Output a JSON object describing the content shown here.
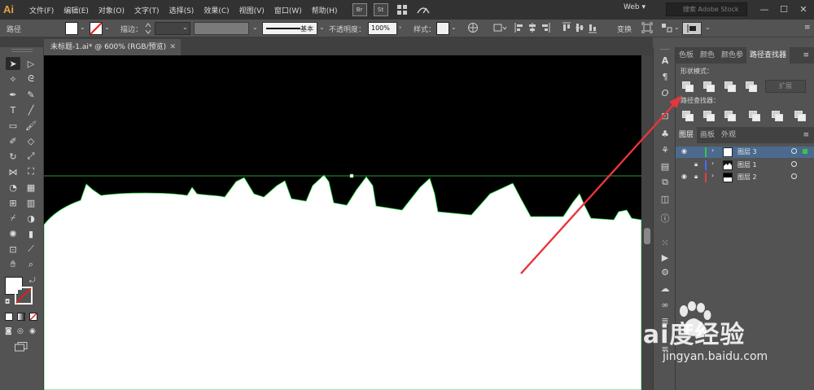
{
  "app": {
    "logo": "Ai"
  },
  "menu": [
    "文件(F)",
    "编辑(E)",
    "对象(O)",
    "文字(T)",
    "选择(S)",
    "效果(C)",
    "视图(V)",
    "窗口(W)",
    "帮助(H)"
  ],
  "app_badges": [
    "Br",
    "St"
  ],
  "workspace": "Web ▾",
  "search": {
    "placeholder": "搜索 Adobe Stock"
  },
  "window_controls": [
    "—",
    "☐",
    "✕"
  ],
  "control_bar": {
    "object_type": "路径",
    "stroke_label": "描边：",
    "stroke_style": "基本",
    "opacity_label": "不透明度：",
    "opacity_value": "100%",
    "style_label": "样式：",
    "transform_label": "变换",
    "colors": {
      "fill": "#ffffff",
      "style_swatch": "#f0f0f0",
      "bar_bg": "#535353"
    }
  },
  "document_tab": {
    "title": "未标题-1.ai* @ 600% (RGB/预览)",
    "close": "✕"
  },
  "tools": [
    "selection-icon",
    "direct-selection-icon",
    "magic-wand-icon",
    "lasso-icon",
    "pen-icon",
    "curvature-icon",
    "type-icon",
    "line-icon",
    "rectangle-icon",
    "paintbrush-icon",
    "shaper-icon",
    "eraser-icon",
    "rotate-icon",
    "scale-icon",
    "width-icon",
    "free-transform-icon",
    "shape-builder-icon",
    "perspective-icon",
    "mesh-icon",
    "gradient-icon",
    "eyedropper-icon",
    "blend-icon",
    "symbol-sprayer-icon",
    "graph-icon",
    "artboard-icon",
    "slice-icon",
    "hand-icon",
    "zoom-icon"
  ],
  "panel_top": {
    "tabs": [
      "色板",
      "颜色",
      "颜色参",
      "路径查找器"
    ],
    "active_tab": 3,
    "shape_modes_label": "形状模式：",
    "expand_label": "扩展",
    "pathfinders_label": "路径查找器："
  },
  "panel_layers": {
    "tabs": [
      "图层",
      "画板",
      "外观"
    ],
    "active_tab": 0,
    "layers": [
      {
        "name": "图层 3",
        "visible": true,
        "locked": false,
        "color": "#3cc24b",
        "selected": true
      },
      {
        "name": "图层 1",
        "visible": false,
        "locked": true,
        "color": "#4b6bff",
        "selected": false
      },
      {
        "name": "图层 2",
        "visible": true,
        "locked": true,
        "color": "#e04040",
        "selected": false
      }
    ]
  },
  "annotation": {
    "arrow_color": "#e8353a"
  },
  "watermark": {
    "brand": "Bai度经验",
    "url": "jingyan.baidu.com"
  }
}
